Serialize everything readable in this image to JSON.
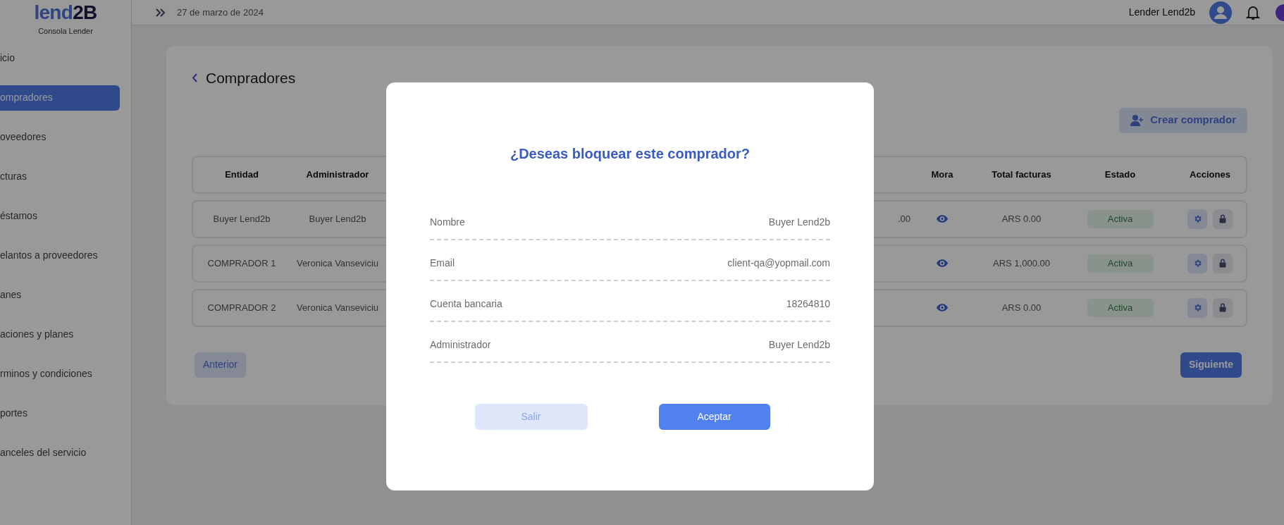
{
  "header": {
    "date": "27 de marzo de 2024",
    "user": "Lender Lend2b"
  },
  "sidebar": {
    "logo_light": "lend",
    "logo_dark": "2B",
    "subtitle": "Consola Lender",
    "items": [
      {
        "label": "icio",
        "selected": false
      },
      {
        "label": "ompradores",
        "selected": true
      },
      {
        "label": "oveedores",
        "selected": false
      },
      {
        "label": "cturas",
        "selected": false
      },
      {
        "label": "éstamos",
        "selected": false
      },
      {
        "label": "elantos a proveedores",
        "selected": false
      },
      {
        "label": "anes",
        "selected": false
      },
      {
        "label": "aciones y planes",
        "selected": false
      },
      {
        "label": "rminos y condiciones",
        "selected": false
      },
      {
        "label": "portes",
        "selected": false
      },
      {
        "label": "anceles del servicio",
        "selected": false
      }
    ]
  },
  "page": {
    "title": "Compradores",
    "create_button": "Crear comprador",
    "table": {
      "columns": {
        "entity": "Entidad",
        "admin": "Administrador",
        "mora": "Mora",
        "total": "Total facturas",
        "status": "Estado",
        "actions": "Acciones"
      },
      "rows": [
        {
          "entity": "Buyer Lend2b",
          "admin": "Buyer Lend2b",
          "column_3": ".00",
          "total": "ARS 0.00",
          "status": "Activa"
        },
        {
          "entity": "COMPRADOR 1",
          "admin": "Veronica Vanseviciu",
          "total": "ARS 1,000.00",
          "status": "Activa"
        },
        {
          "entity": "COMPRADOR 2",
          "admin": "Veronica Vanseviciu",
          "total": "ARS 0.00",
          "status": "Activa"
        }
      ]
    },
    "prev_button": "Anterior",
    "next_button": "Siguiente"
  },
  "dialog": {
    "title": "¿Deseas bloquear este comprador?",
    "fields": [
      {
        "label": "Nombre",
        "value": "Buyer Lend2b"
      },
      {
        "label": "Email",
        "value": "client-qa@yopmail.com"
      },
      {
        "label": "Cuenta bancaria",
        "value": "18264810"
      },
      {
        "label": "Administrador",
        "value": "Buyer Lend2b"
      }
    ],
    "cancel_button": "Salir",
    "confirm_button": "Aceptar"
  }
}
